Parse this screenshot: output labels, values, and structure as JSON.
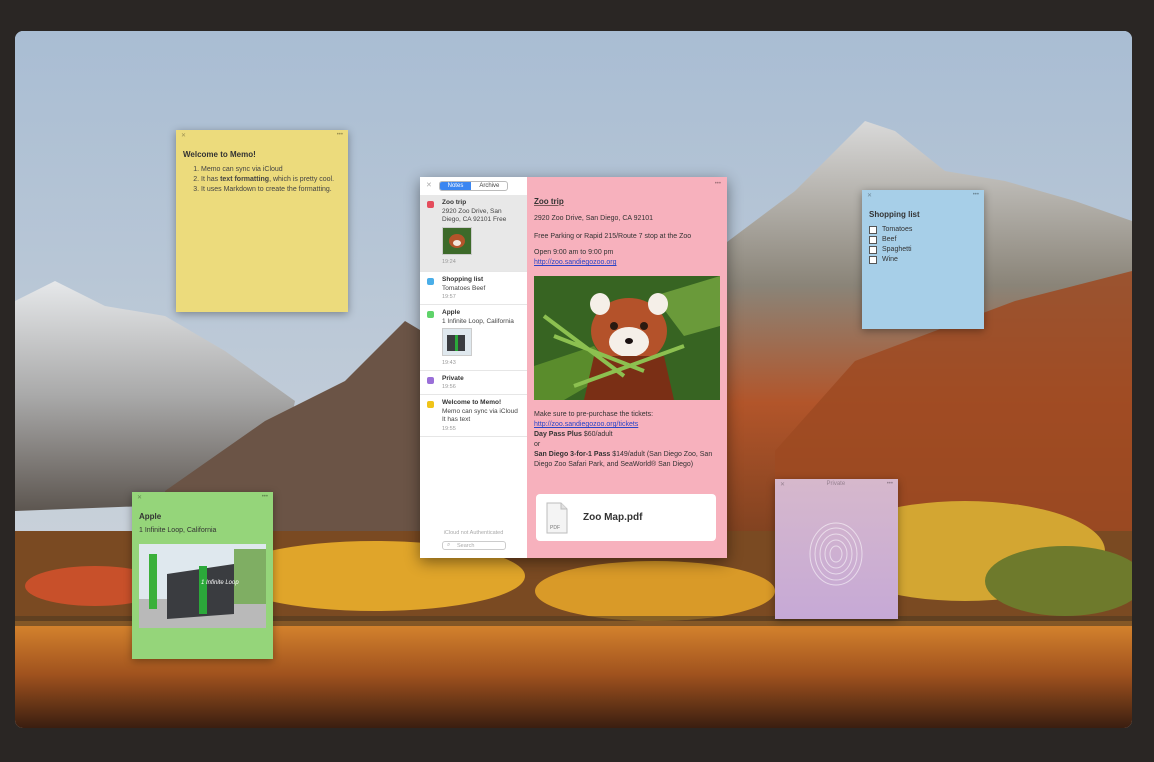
{
  "welcome_note": {
    "close": "✕",
    "more": "•••",
    "title": "Welcome to Memo!",
    "items": [
      "Memo can sync via iCloud",
      "It has text formatting, which is pretty cool.",
      "It uses Markdown to create the formatting."
    ],
    "bold_phrase": "text formatting"
  },
  "shopping_note": {
    "close": "✕",
    "more": "•••",
    "title": "Shopping list",
    "items": [
      "Tomatoes",
      "Beef",
      "Spaghetti",
      "Wine"
    ]
  },
  "apple_note": {
    "close": "✕",
    "more": "•••",
    "title": "Apple",
    "address": "1 Infinite Loop, California",
    "sign_text": "1 Infinite Loop"
  },
  "private_note": {
    "close": "✕",
    "title": "Private",
    "more": "•••"
  },
  "memo_window": {
    "sidebar": {
      "close": "✕",
      "tabs": [
        "Notes",
        "Archive"
      ],
      "active_tab": "Notes",
      "notes": [
        {
          "title": "Zoo trip",
          "preview": "2920 Zoo Drive, San Diego, CA 92101 Free",
          "time": "19:24",
          "color": "#e44c5c"
        },
        {
          "title": "Shopping list",
          "preview": "Tomatoes Beef",
          "time": "19:57",
          "color": "#4aaee8"
        },
        {
          "title": "Apple",
          "preview": "1 Infinite Loop, California",
          "time": "19:43",
          "color": "#5fd36a"
        },
        {
          "title": "Private",
          "preview": "",
          "time": "19:56",
          "color": "#9a6fd8"
        },
        {
          "title": "Welcome to Memo!",
          "preview": "Memo can sync via iCloud It has text",
          "time": "19:55",
          "color": "#f0c419"
        }
      ],
      "status": "iCloud not Authenticated",
      "search_placeholder": "Search"
    },
    "editor": {
      "more": "•••",
      "title": "Zoo trip",
      "address": "2920 Zoo Drive, San Diego, CA 92101",
      "parking": "Free Parking or Rapid 215/Route 7 stop at the Zoo",
      "hours": "Open 9:00 am to 9:00 pm",
      "link": "http://zoo.sandiegozoo.org",
      "tickets_intro": "Make sure to pre-purchase the tickets: ",
      "tickets_link": "http://zoo.sandiegozoo.org/tickets",
      "pass1_name": "Day Pass Plus",
      "pass1_price": " $60/adult",
      "or": "or",
      "pass2_name": "San Diego 3-for-1 Pass",
      "pass2_detail": " $149/adult (San Diego Zoo, San Diego Zoo Safari Park, and SeaWorld® San Diego)",
      "attachment_name": "Zoo Map.pdf",
      "attachment_type": "PDF"
    }
  }
}
